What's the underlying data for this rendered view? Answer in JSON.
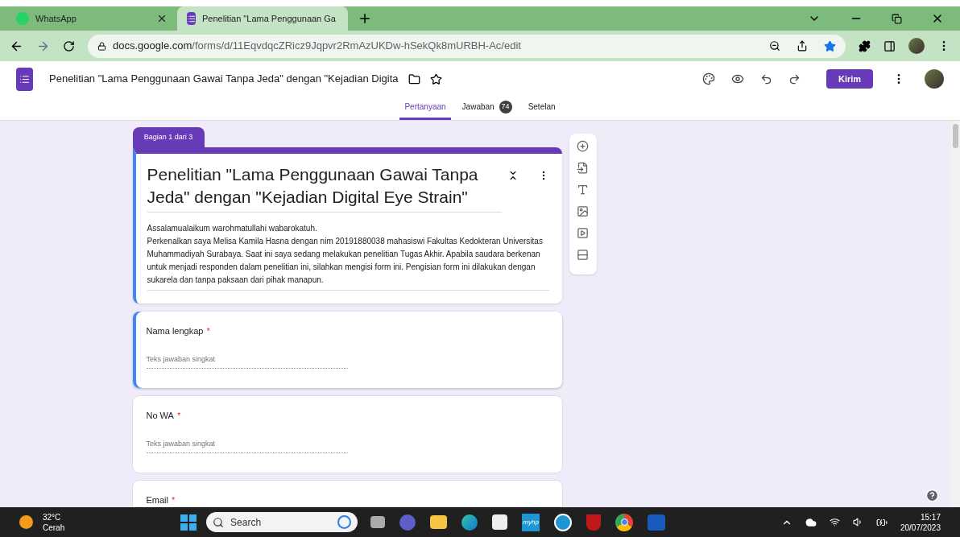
{
  "browser": {
    "tabs": [
      {
        "kind": "whatsapp",
        "title": "WhatsApp",
        "selected": false
      },
      {
        "kind": "forms",
        "title": "Penelitian \"Lama Penggunaan Ga",
        "selected": true
      }
    ],
    "url_host": "docs.google.com",
    "url_path": "/forms/d/11EqvdqcZRicz9Jqpvr2RmAzUKDw-hSekQk8mURBH-Ac/edit",
    "bookmarked": true
  },
  "app_bar": {
    "doc_title": "Penelitian \"Lama Penggunaan Gawai Tanpa Jeda\" dengan \"Kejadian Digita",
    "send_button": "Kirim"
  },
  "form_tabs": [
    {
      "label": "Pertanyaan",
      "selected": true
    },
    {
      "label": "Jawaban",
      "selected": false,
      "badge": "74"
    },
    {
      "label": "Setelan",
      "selected": false
    }
  ],
  "section": {
    "label": "Bagian 1 dari 3",
    "title": "Penelitian \"Lama Penggunaan Gawai Tanpa Jeda\" dengan \"Kejadian Digital Eye Strain\"",
    "description": [
      "Assalamualaikum warohmatullahi wabarokatuh.",
      "Perkenalkan saya Melisa Kamila Hasna dengan nim 20191880038 mahasiswi Fakultas Kedokteran Universitas Muhammadiyah Surabaya. Saat ini saya sedang melakukan penelitian Tugas Akhir. Apabila saudara berkenan untuk menjadi responden dalam penelitian ini, silahkan mengisi form ini. Pengisian form ini dilakukan dengan sukarela dan tanpa paksaan dari pihak manapun."
    ],
    "selected": true
  },
  "questions": [
    {
      "title": "Nama lengkap",
      "required": true,
      "required_mark": "*",
      "placeholder": "Teks jawaban singkat",
      "selected": true
    },
    {
      "title": "No WA",
      "required": true,
      "required_mark": "*",
      "placeholder": "Teks jawaban singkat",
      "selected": false
    },
    {
      "title": "Email",
      "required": true,
      "required_mark": "*",
      "selected": false
    }
  ],
  "taskbar": {
    "weather_temp": "32°C",
    "weather_text": "Cerah",
    "search_placeholder": "Search",
    "myhp_label": "myhp",
    "time": "15:17",
    "date": "20/07/2023"
  }
}
